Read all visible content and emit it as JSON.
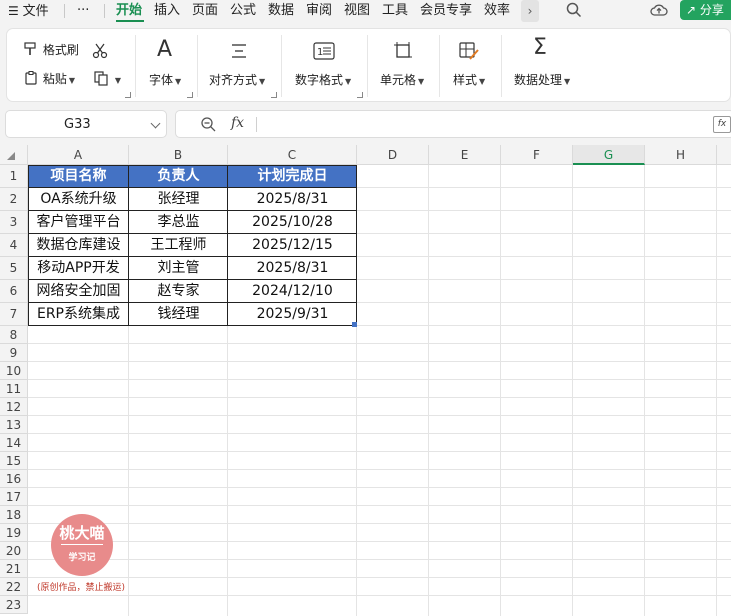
{
  "menubar": {
    "file": "文件",
    "more_dots": "···",
    "tabs": [
      "开始",
      "插入",
      "页面",
      "公式",
      "数据",
      "审阅",
      "视图",
      "工具",
      "会员专享",
      "效率"
    ],
    "active_tab": "开始",
    "more_arrow": "›",
    "share": "分享"
  },
  "ribbon": {
    "format_painter": "格式刷",
    "paste": "粘贴",
    "font": "字体",
    "align": "对齐方式",
    "number_format": "数字格式",
    "cell": "单元格",
    "style": "样式",
    "data_process": "数据处理"
  },
  "formula_bar": {
    "name_box": "G33",
    "fx": "fx",
    "formula": ""
  },
  "sheet": {
    "columns": [
      "A",
      "B",
      "C",
      "D",
      "E",
      "F",
      "G",
      "H"
    ],
    "selected_column": "G",
    "rows": [
      "1",
      "2",
      "3",
      "4",
      "5",
      "6",
      "7",
      "8",
      "9",
      "10",
      "11",
      "12",
      "13",
      "14",
      "15",
      "16",
      "17",
      "18",
      "19",
      "20",
      "21",
      "22",
      "23"
    ],
    "table": {
      "headers": [
        "项目名称",
        "负责人",
        "计划完成日"
      ],
      "rows": [
        [
          "OA系统升级",
          "张经理",
          "2025/8/31"
        ],
        [
          "客户管理平台",
          "李总监",
          "2025/10/28"
        ],
        [
          "数据仓库建设",
          "王工程师",
          "2025/12/15"
        ],
        [
          "移动APP开发",
          "刘主管",
          "2025/8/31"
        ],
        [
          "网络安全加固",
          "赵专家",
          "2024/12/10"
        ],
        [
          "ERP系统集成",
          "钱经理",
          "2025/9/31"
        ]
      ]
    },
    "header_color": "#4472c4",
    "accent_color": "#1a8f52"
  },
  "watermark": {
    "title": "桃大喵",
    "subtitle": "学习记",
    "note": "(原创作品，禁止搬运)"
  }
}
